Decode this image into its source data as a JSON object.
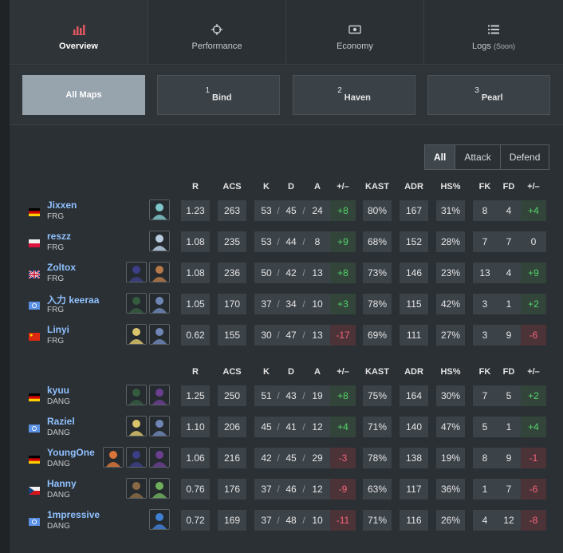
{
  "tabs": [
    {
      "label": "Overview",
      "icon": "bar-chart-icon",
      "active": true
    },
    {
      "label": "Performance",
      "icon": "crosshair-icon",
      "active": false
    },
    {
      "label": "Economy",
      "icon": "cash-icon",
      "active": false
    },
    {
      "label": "Logs",
      "soon": "(Soon)",
      "icon": "list-icon",
      "active": false
    }
  ],
  "maps": [
    {
      "num": "",
      "label": "All Maps",
      "active": true
    },
    {
      "num": "1",
      "label": "Bind",
      "active": false
    },
    {
      "num": "2",
      "label": "Haven",
      "active": false
    },
    {
      "num": "3",
      "label": "Pearl",
      "active": false
    }
  ],
  "side_filter": {
    "all": "All",
    "attack": "Attack",
    "defend": "Defend",
    "active": "All"
  },
  "columns": {
    "r": "R",
    "acs": "ACS",
    "k": "K",
    "d": "D",
    "a": "A",
    "pm": "+/–",
    "kast": "KAST",
    "adr": "ADR",
    "hs": "HS%",
    "fk": "FK",
    "fd": "FD",
    "fpm": "+/–"
  },
  "teams": [
    {
      "players": [
        {
          "name": "Jixxen",
          "team": "FRG",
          "flag": "de",
          "agents": [
            "agent-sage"
          ],
          "r": "1.23",
          "acs": "263",
          "k": "53",
          "d": "45",
          "a": "24",
          "pm": "+8",
          "pm_sign": "pos",
          "kast": "80%",
          "adr": "167",
          "hs": "31%",
          "fk": "8",
          "fd": "4",
          "fpm": "+4",
          "fpm_sign": "pos"
        },
        {
          "name": "reszz",
          "team": "FRG",
          "flag": "pl",
          "agents": [
            "agent-jett"
          ],
          "r": "1.08",
          "acs": "235",
          "k": "53",
          "d": "44",
          "a": "8",
          "pm": "+9",
          "pm_sign": "pos",
          "kast": "68%",
          "adr": "152",
          "hs": "28%",
          "fk": "7",
          "fd": "7",
          "fpm": "0",
          "fpm_sign": "neu"
        },
        {
          "name": "Zoltox",
          "team": "FRG",
          "flag": "gb",
          "agents": [
            "agent-omen",
            "agent-breach"
          ],
          "r": "1.08",
          "acs": "236",
          "k": "50",
          "d": "42",
          "a": "13",
          "pm": "+8",
          "pm_sign": "pos",
          "kast": "73%",
          "adr": "146",
          "hs": "23%",
          "fk": "13",
          "fd": "4",
          "fpm": "+9",
          "fpm_sign": "pos"
        },
        {
          "name": "入力 keeraa",
          "team": "FRG",
          "flag": "un",
          "agents": [
            "agent-viper",
            "agent-sova"
          ],
          "r": "1.05",
          "acs": "170",
          "k": "37",
          "d": "34",
          "a": "10",
          "pm": "+3",
          "pm_sign": "pos",
          "kast": "78%",
          "adr": "115",
          "hs": "42%",
          "fk": "3",
          "fd": "1",
          "fpm": "+2",
          "fpm_sign": "pos"
        },
        {
          "name": "Linyi",
          "team": "FRG",
          "flag": "cn",
          "agents": [
            "agent-killjoy",
            "agent-sova"
          ],
          "r": "0.62",
          "acs": "155",
          "k": "30",
          "d": "47",
          "a": "13",
          "pm": "-17",
          "pm_sign": "neg",
          "kast": "69%",
          "adr": "111",
          "hs": "27%",
          "fk": "3",
          "fd": "9",
          "fpm": "-6",
          "fpm_sign": "neg"
        }
      ]
    },
    {
      "players": [
        {
          "name": "kyuu",
          "team": "DANG",
          "flag": "de",
          "agents": [
            "agent-viper",
            "agent-astra"
          ],
          "r": "1.25",
          "acs": "250",
          "k": "51",
          "d": "43",
          "a": "19",
          "pm": "+8",
          "pm_sign": "pos",
          "kast": "75%",
          "adr": "164",
          "hs": "30%",
          "fk": "7",
          "fd": "5",
          "fpm": "+2",
          "fpm_sign": "pos"
        },
        {
          "name": "Raziel",
          "team": "DANG",
          "flag": "un",
          "agents": [
            "agent-killjoy",
            "agent-sova"
          ],
          "r": "1.10",
          "acs": "206",
          "k": "45",
          "d": "41",
          "a": "12",
          "pm": "+4",
          "pm_sign": "pos",
          "kast": "71%",
          "adr": "140",
          "hs": "47%",
          "fk": "5",
          "fd": "1",
          "fpm": "+4",
          "fpm_sign": "pos"
        },
        {
          "name": "YoungOne",
          "team": "DANG",
          "flag": "de",
          "agents": [
            "agent-raze",
            "agent-omen",
            "agent-astra"
          ],
          "r": "1.06",
          "acs": "216",
          "k": "42",
          "d": "45",
          "a": "29",
          "pm": "-3",
          "pm_sign": "neg",
          "kast": "78%",
          "adr": "138",
          "hs": "19%",
          "fk": "8",
          "fd": "9",
          "fpm": "-1",
          "fpm_sign": "neg"
        },
        {
          "name": "Hanny",
          "team": "DANG",
          "flag": "cz",
          "agents": [
            "agent-chamber",
            "agent-skye"
          ],
          "r": "0.76",
          "acs": "176",
          "k": "37",
          "d": "46",
          "a": "12",
          "pm": "-9",
          "pm_sign": "neg",
          "kast": "63%",
          "adr": "117",
          "hs": "36%",
          "fk": "1",
          "fd": "7",
          "fpm": "-6",
          "fpm_sign": "neg"
        },
        {
          "name": "1mpressive",
          "team": "DANG",
          "flag": "un",
          "agents": [
            "agent-neon"
          ],
          "r": "0.72",
          "acs": "169",
          "k": "37",
          "d": "48",
          "a": "10",
          "pm": "-11",
          "pm_sign": "neg",
          "kast": "71%",
          "adr": "116",
          "hs": "26%",
          "fk": "4",
          "fd": "12",
          "fpm": "-8",
          "fpm_sign": "neg"
        }
      ]
    }
  ],
  "colors": {
    "positive": "#53d46a",
    "negative": "#f2657a",
    "player_name": "#8fc1ff",
    "active_map": "#97a3ad"
  }
}
